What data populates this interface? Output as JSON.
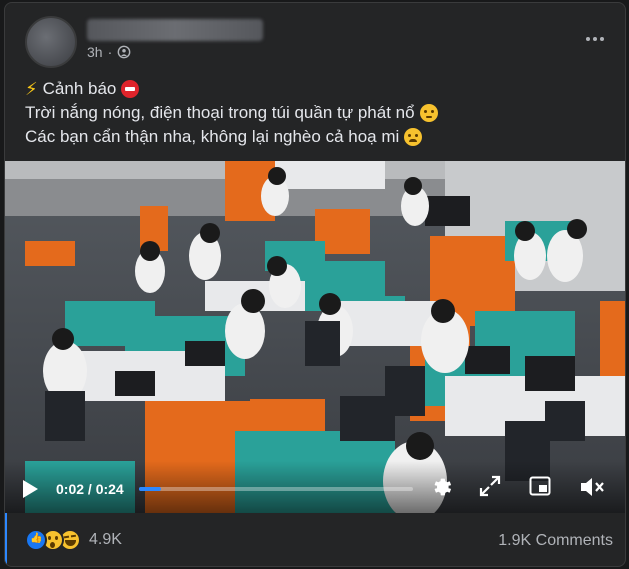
{
  "post": {
    "timestamp": "3h",
    "audience_icon": "friends-icon",
    "caption": {
      "line1_text": "Cảnh báo",
      "line2_text": "Trời nắng nóng, điện thoại trong túi quần tự phát nổ",
      "line3_text": "Các bạn cẩn thận nha, không lại nghèo cả hoạ mi"
    }
  },
  "video": {
    "time_display": "0:02 / 0:24",
    "progress_fraction": 0.08
  },
  "footer": {
    "reaction_icons": [
      "like-icon",
      "wow-icon",
      "haha-icon"
    ],
    "reaction_count": "4.9K",
    "comments_label": "1.9K Comments"
  },
  "colors": {
    "accent": "#2d88ff",
    "card_bg": "#242526",
    "secondary_text": "#b0b3b8"
  }
}
